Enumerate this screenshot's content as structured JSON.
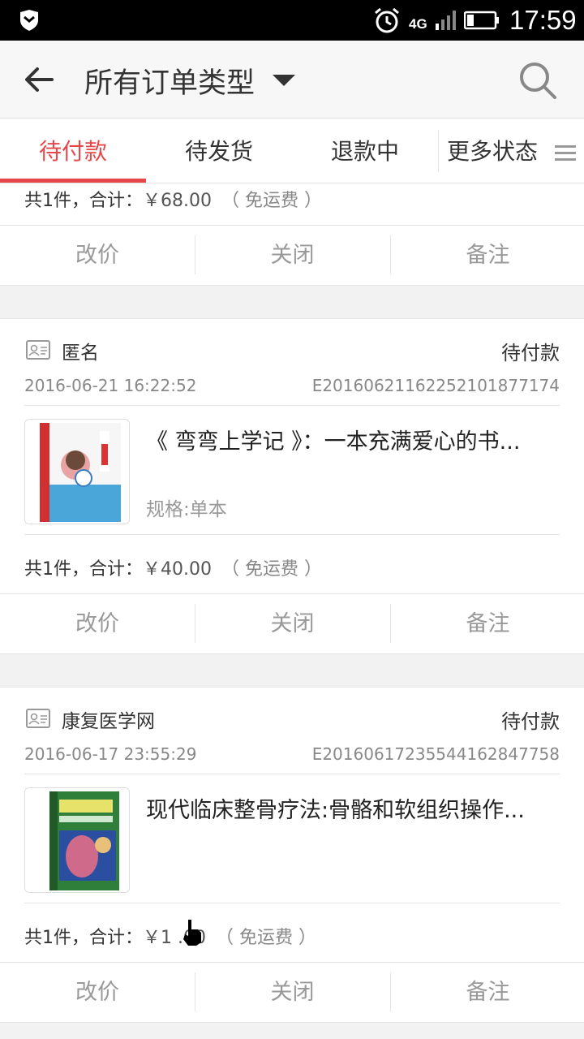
{
  "status_bar": {
    "network": "4G",
    "time": "17:59"
  },
  "header": {
    "title": "所有订单类型"
  },
  "tabs": [
    {
      "label": "待付款"
    },
    {
      "label": "待发货"
    },
    {
      "label": "退款中"
    },
    {
      "label": "更多状态"
    }
  ],
  "colors": {
    "accent": "#e8474a"
  },
  "actions": {
    "change_price": "改价",
    "close": "关闭",
    "note": "备注"
  },
  "orders": [
    {
      "summary_prefix": "共1件，合计：",
      "price": "￥68.00",
      "shipping": "（ 免运费 ）"
    },
    {
      "buyer": "匿名",
      "status": "待付款",
      "date": "2016-06-21 16:22:52",
      "order_no": "E20160621162252101877174",
      "product_name": "《 弯弯上学记 》：一本充满爱心的书...",
      "spec": "规格:单本",
      "summary_prefix": "共1件，合计：",
      "price": "￥40.00",
      "shipping": "（ 免运费 ）"
    },
    {
      "buyer": "康复医学网",
      "status": "待付款",
      "date": "2016-06-17 23:55:29",
      "order_no": "E20160617235544162847758",
      "product_name": "现代临床整骨疗法:骨骼和软组织操作...",
      "summary_prefix": "共1件，合计：",
      "price": "￥1  .00",
      "shipping": "（ 免运费 ）"
    }
  ]
}
